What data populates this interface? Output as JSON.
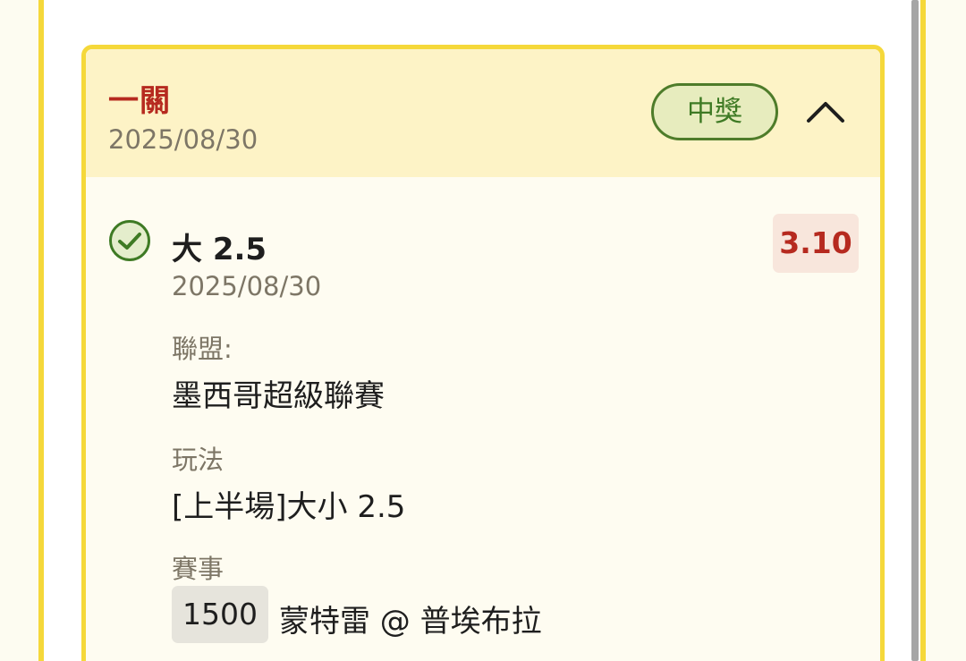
{
  "bet_card": {
    "bet_type": "一關",
    "date": "2025/08/30",
    "status": "中獎",
    "collapse_icon": "chevron-up-icon"
  },
  "selection": {
    "status_icon": "check-circle-icon",
    "name": "大 2.5",
    "date": "2025/08/30",
    "odds": "3.10",
    "league_label": "聯盟:",
    "league_value": "墨西哥超級聯賽",
    "play_label": "玩法",
    "play_value": "[上半場]大小 2.5",
    "match_label": "賽事",
    "match_code": "1500",
    "match_name": "蒙特雷 @ 普埃布拉"
  },
  "colors": {
    "accent_border": "#f5d83a",
    "header_bg": "#fdf3c6",
    "win_green": "#3e7a24",
    "odds_red": "#b62a1f"
  }
}
